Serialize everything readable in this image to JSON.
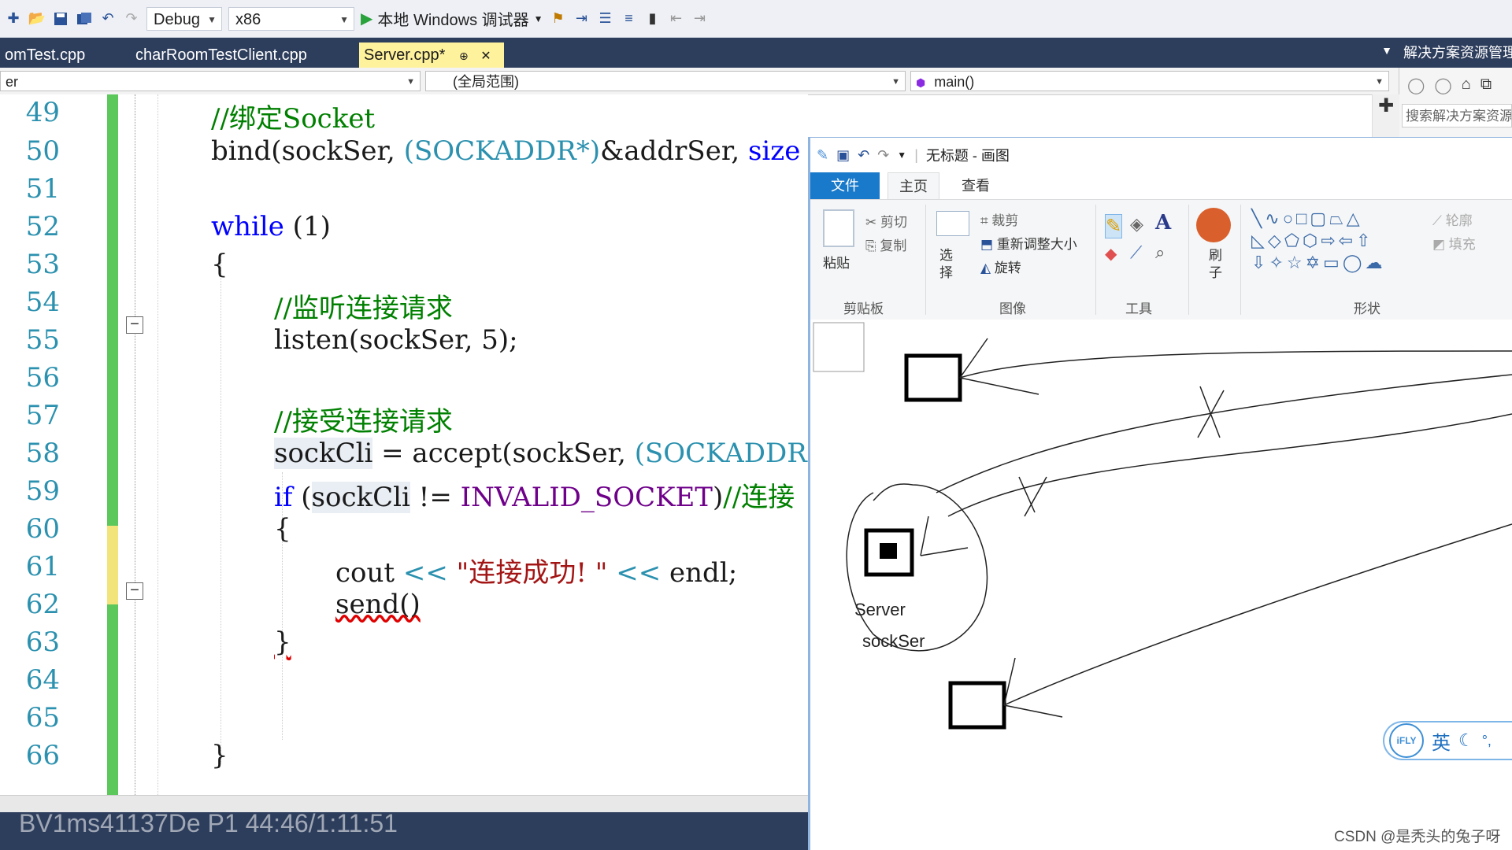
{
  "toolbar": {
    "config": "Debug",
    "platform": "x86",
    "run_label": "本地 Windows 调试器"
  },
  "tabs": [
    {
      "label": "omTest.cpp",
      "active": false
    },
    {
      "label": "charRoomTestClient.cpp",
      "active": false
    },
    {
      "label": "Server.cpp*",
      "active": true
    }
  ],
  "tab_pin": "⊕",
  "tab_close": "✕",
  "solution_explorer": {
    "title": "解决方案资源管理",
    "search_placeholder": "搜索解决方案资源"
  },
  "navbar": {
    "project": "er",
    "scope": "(全局范围)",
    "member": "main()"
  },
  "code": {
    "line_numbers": [
      "49",
      "50",
      "51",
      "52",
      "53",
      "54",
      "55",
      "56",
      "57",
      "58",
      "59",
      "60",
      "61",
      "62",
      "63",
      "64",
      "65",
      "66"
    ],
    "l49_comment": "//绑定Socket",
    "l50_a": "bind(sockSer, ",
    "l50_type": "(SOCKADDR*)",
    "l50_b": "&addrSer, ",
    "l50_c": "size",
    "l52_kw": "while",
    "l52_rest": " (1)",
    "l53": "{",
    "l54_comment": "//监听连接请求",
    "l55": "listen(sockSer, 5);",
    "l57_comment": "//接受连接请求",
    "l58_var": "sockCli",
    "l58_rest": " = accept(sockSer, ",
    "l58_type": "(SOCKADDR",
    "l59_kw": "if",
    "l59_a": " (",
    "l59_var": "sockCli",
    "l59_b": " != ",
    "l59_macro": "INVALID_SOCKET",
    "l59_c": ")",
    "l59_comment": "//连接",
    "l60": "{",
    "l61_a": "cout ",
    "l61_op1": "<<",
    "l61_str": " \"连接成功! \" ",
    "l61_op2": "<<",
    "l61_b": " endl;",
    "l62": "send()",
    "l63": "}",
    "l66": "}",
    "fold_symbol": "−"
  },
  "watermark": "BV1ms41137De P1 44:46/1:11:51",
  "paint": {
    "title": "无标题 - 画图",
    "tabs": {
      "file": "文件",
      "home": "主页",
      "view": "查看"
    },
    "ribbon": {
      "paste": "粘贴",
      "cut": "剪切",
      "copy": "复制",
      "select": "选择",
      "crop": "裁剪",
      "resize": "重新调整大小",
      "rotate": "旋转",
      "brush": "刷子",
      "outline": "轮廓",
      "fill": "填充",
      "group_clipboard": "剪贴板",
      "group_image": "图像",
      "group_tools": "工具",
      "group_shapes": "形状"
    },
    "canvas_text": {
      "server": "Server",
      "sockser": "sockSer"
    }
  },
  "ifly": {
    "logo": "iFLY",
    "lang": "英"
  },
  "csdn_watermark": "CSDN @是秃头的兔子呀"
}
